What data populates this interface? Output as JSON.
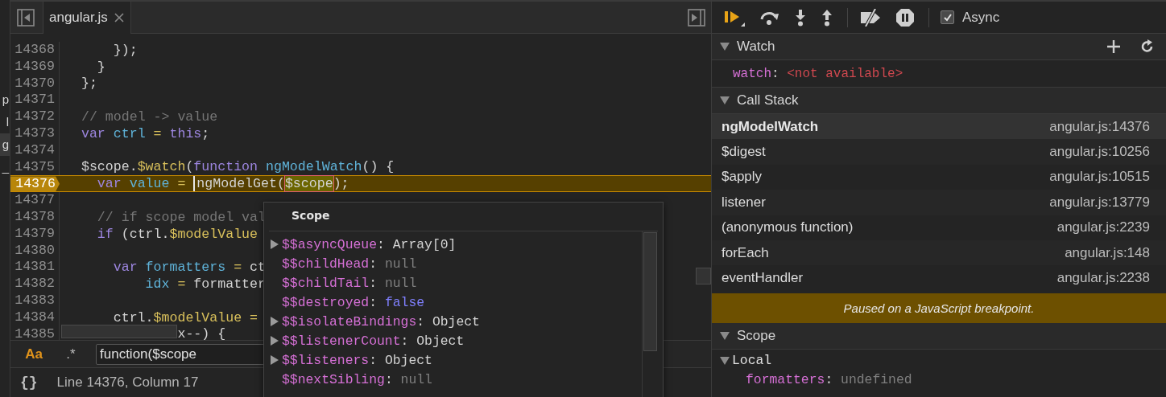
{
  "sidebar_fragments": [
    {
      "text": "p",
      "selected": false
    },
    {
      "text": "l",
      "selected": false
    },
    {
      "text": "g",
      "selected": true
    },
    {
      "text": "_",
      "selected": false
    }
  ],
  "editor": {
    "tabs": [
      {
        "label": "angular.js",
        "selected": true
      }
    ],
    "lines": [
      {
        "number": "14368",
        "paused": false,
        "tokens": [
          {
            "text": "      });",
            "kind": "plain"
          }
        ]
      },
      {
        "number": "14369",
        "paused": false,
        "tokens": [
          {
            "text": "    }",
            "kind": "plain"
          }
        ]
      },
      {
        "number": "14370",
        "paused": false,
        "tokens": [
          {
            "text": "  };",
            "kind": "plain"
          }
        ]
      },
      {
        "number": "14371",
        "paused": false
      },
      {
        "number": "14372",
        "paused": false,
        "tokens": [
          {
            "text": "  // model -> value",
            "kind": "comment"
          }
        ]
      },
      {
        "number": "14373",
        "paused": false,
        "tokens": [
          {
            "text": "  var",
            "kind": "keyword"
          },
          {
            "text": " ctrl",
            "kind": "def"
          },
          {
            "text": " = ",
            "kind": "op"
          },
          {
            "text": "this",
            "kind": "keyword"
          },
          {
            "text": ";",
            "kind": "plain"
          }
        ]
      },
      {
        "number": "14374",
        "paused": false
      },
      {
        "number": "14375",
        "paused": false,
        "tokens": [
          {
            "text": "  $scope.",
            "kind": "plain"
          },
          {
            "text": "$watch",
            "kind": "prop"
          },
          {
            "text": "(",
            "kind": "plain"
          },
          {
            "text": "function",
            "kind": "keyword"
          },
          {
            "text": " ngModelWatch",
            "kind": "def"
          },
          {
            "text": "() {",
            "kind": "plain"
          }
        ]
      },
      {
        "number": "14376",
        "paused": true,
        "tokens": [
          {
            "text": "    var",
            "kind": "keyword"
          },
          {
            "text": " value",
            "kind": "def"
          },
          {
            "text": " = ",
            "kind": "op"
          },
          {
            "text": "ngModelGet(",
            "kind": "cursor"
          },
          {
            "text": "$scope",
            "kind": "eval"
          },
          {
            "text": ");",
            "kind": "plain"
          }
        ]
      },
      {
        "number": "14377",
        "paused": false
      },
      {
        "number": "14378",
        "paused": false,
        "tokens": [
          {
            "text": "    // if scope model val",
            "kind": "comment"
          }
        ]
      },
      {
        "number": "14379",
        "paused": false,
        "tokens": [
          {
            "text": "    if",
            "kind": "keyword"
          },
          {
            "text": " (ctrl.",
            "kind": "plain"
          },
          {
            "text": "$modelValue",
            "kind": "prop"
          }
        ]
      },
      {
        "number": "14380",
        "paused": false
      },
      {
        "number": "14381",
        "paused": false,
        "tokens": [
          {
            "text": "      var",
            "kind": "keyword"
          },
          {
            "text": " formatters",
            "kind": "def"
          },
          {
            "text": " = ",
            "kind": "op"
          },
          {
            "text": "ct",
            "kind": "plain"
          }
        ]
      },
      {
        "number": "14382",
        "paused": false,
        "tokens": [
          {
            "text": "          idx",
            "kind": "def"
          },
          {
            "text": " = ",
            "kind": "op"
          },
          {
            "text": "formatter",
            "kind": "plain"
          }
        ]
      },
      {
        "number": "14383",
        "paused": false
      },
      {
        "number": "14384",
        "paused": false,
        "tokens": [
          {
            "text": "      ctrl.",
            "kind": "plain"
          },
          {
            "text": "$modelValue",
            "kind": "prop"
          },
          {
            "text": " =",
            "kind": "op"
          }
        ]
      },
      {
        "number": "14385",
        "paused": false,
        "tokens": [
          {
            "text": "              x--) {",
            "kind": "plain"
          }
        ]
      }
    ],
    "search": {
      "toggles": [
        {
          "label": "Aa",
          "on": true
        },
        {
          "label": ".*",
          "on": false
        }
      ],
      "value": "function($scope"
    },
    "format_button": "{}",
    "status": "Line 14376, Column 17"
  },
  "popover": {
    "title": "Scope",
    "rows": [
      {
        "key": "$$asyncQueue",
        "sep": ":",
        "value": "Array[0]",
        "kind": "object",
        "expandable": true
      },
      {
        "key": "$$childHead",
        "sep": ":",
        "value": "null",
        "kind": "null",
        "expandable": false
      },
      {
        "key": "$$childTail",
        "sep": ":",
        "value": "null",
        "kind": "null",
        "expandable": false
      },
      {
        "key": "$$destroyed",
        "sep": ":",
        "value": "false",
        "kind": "bool",
        "expandable": false
      },
      {
        "key": "$$isolateBindings",
        "sep": ":",
        "value": "Object",
        "kind": "object",
        "expandable": true
      },
      {
        "key": "$$listenerCount",
        "sep": ":",
        "value": "Object",
        "kind": "object",
        "expandable": true
      },
      {
        "key": "$$listeners",
        "sep": ":",
        "value": "Object",
        "kind": "object",
        "expandable": true
      },
      {
        "key": "$$nextSibling",
        "sep": ":",
        "value": "null",
        "kind": "null",
        "expandable": false
      }
    ]
  },
  "debugger": {
    "async": {
      "label": "Async",
      "checked": true
    },
    "watch": {
      "title": "Watch",
      "expanded": true,
      "items": [
        {
          "name": "watch",
          "sep": ":",
          "value": "<not available>"
        }
      ]
    },
    "call_stack": {
      "title": "Call Stack",
      "expanded": true,
      "frames": [
        {
          "name": "ngModelWatch",
          "location": "angular.js:14376",
          "selected": true
        },
        {
          "name": "$digest",
          "location": "angular.js:10256",
          "selected": false
        },
        {
          "name": "$apply",
          "location": "angular.js:10515",
          "selected": false
        },
        {
          "name": "listener",
          "location": "angular.js:13779",
          "selected": false
        },
        {
          "name": "(anonymous function)",
          "location": "angular.js:2239",
          "selected": false
        },
        {
          "name": "forEach",
          "location": "angular.js:148",
          "selected": false
        },
        {
          "name": "eventHandler",
          "location": "angular.js:2238",
          "selected": false
        }
      ]
    },
    "banner": "Paused on a JavaScript breakpoint.",
    "scope": {
      "title": "Scope",
      "expanded": true,
      "groups": [
        {
          "name": "Local",
          "expanded": true,
          "items": [
            {
              "name": "formatters",
              "sep": ":",
              "value": "undefined"
            }
          ]
        }
      ]
    }
  }
}
